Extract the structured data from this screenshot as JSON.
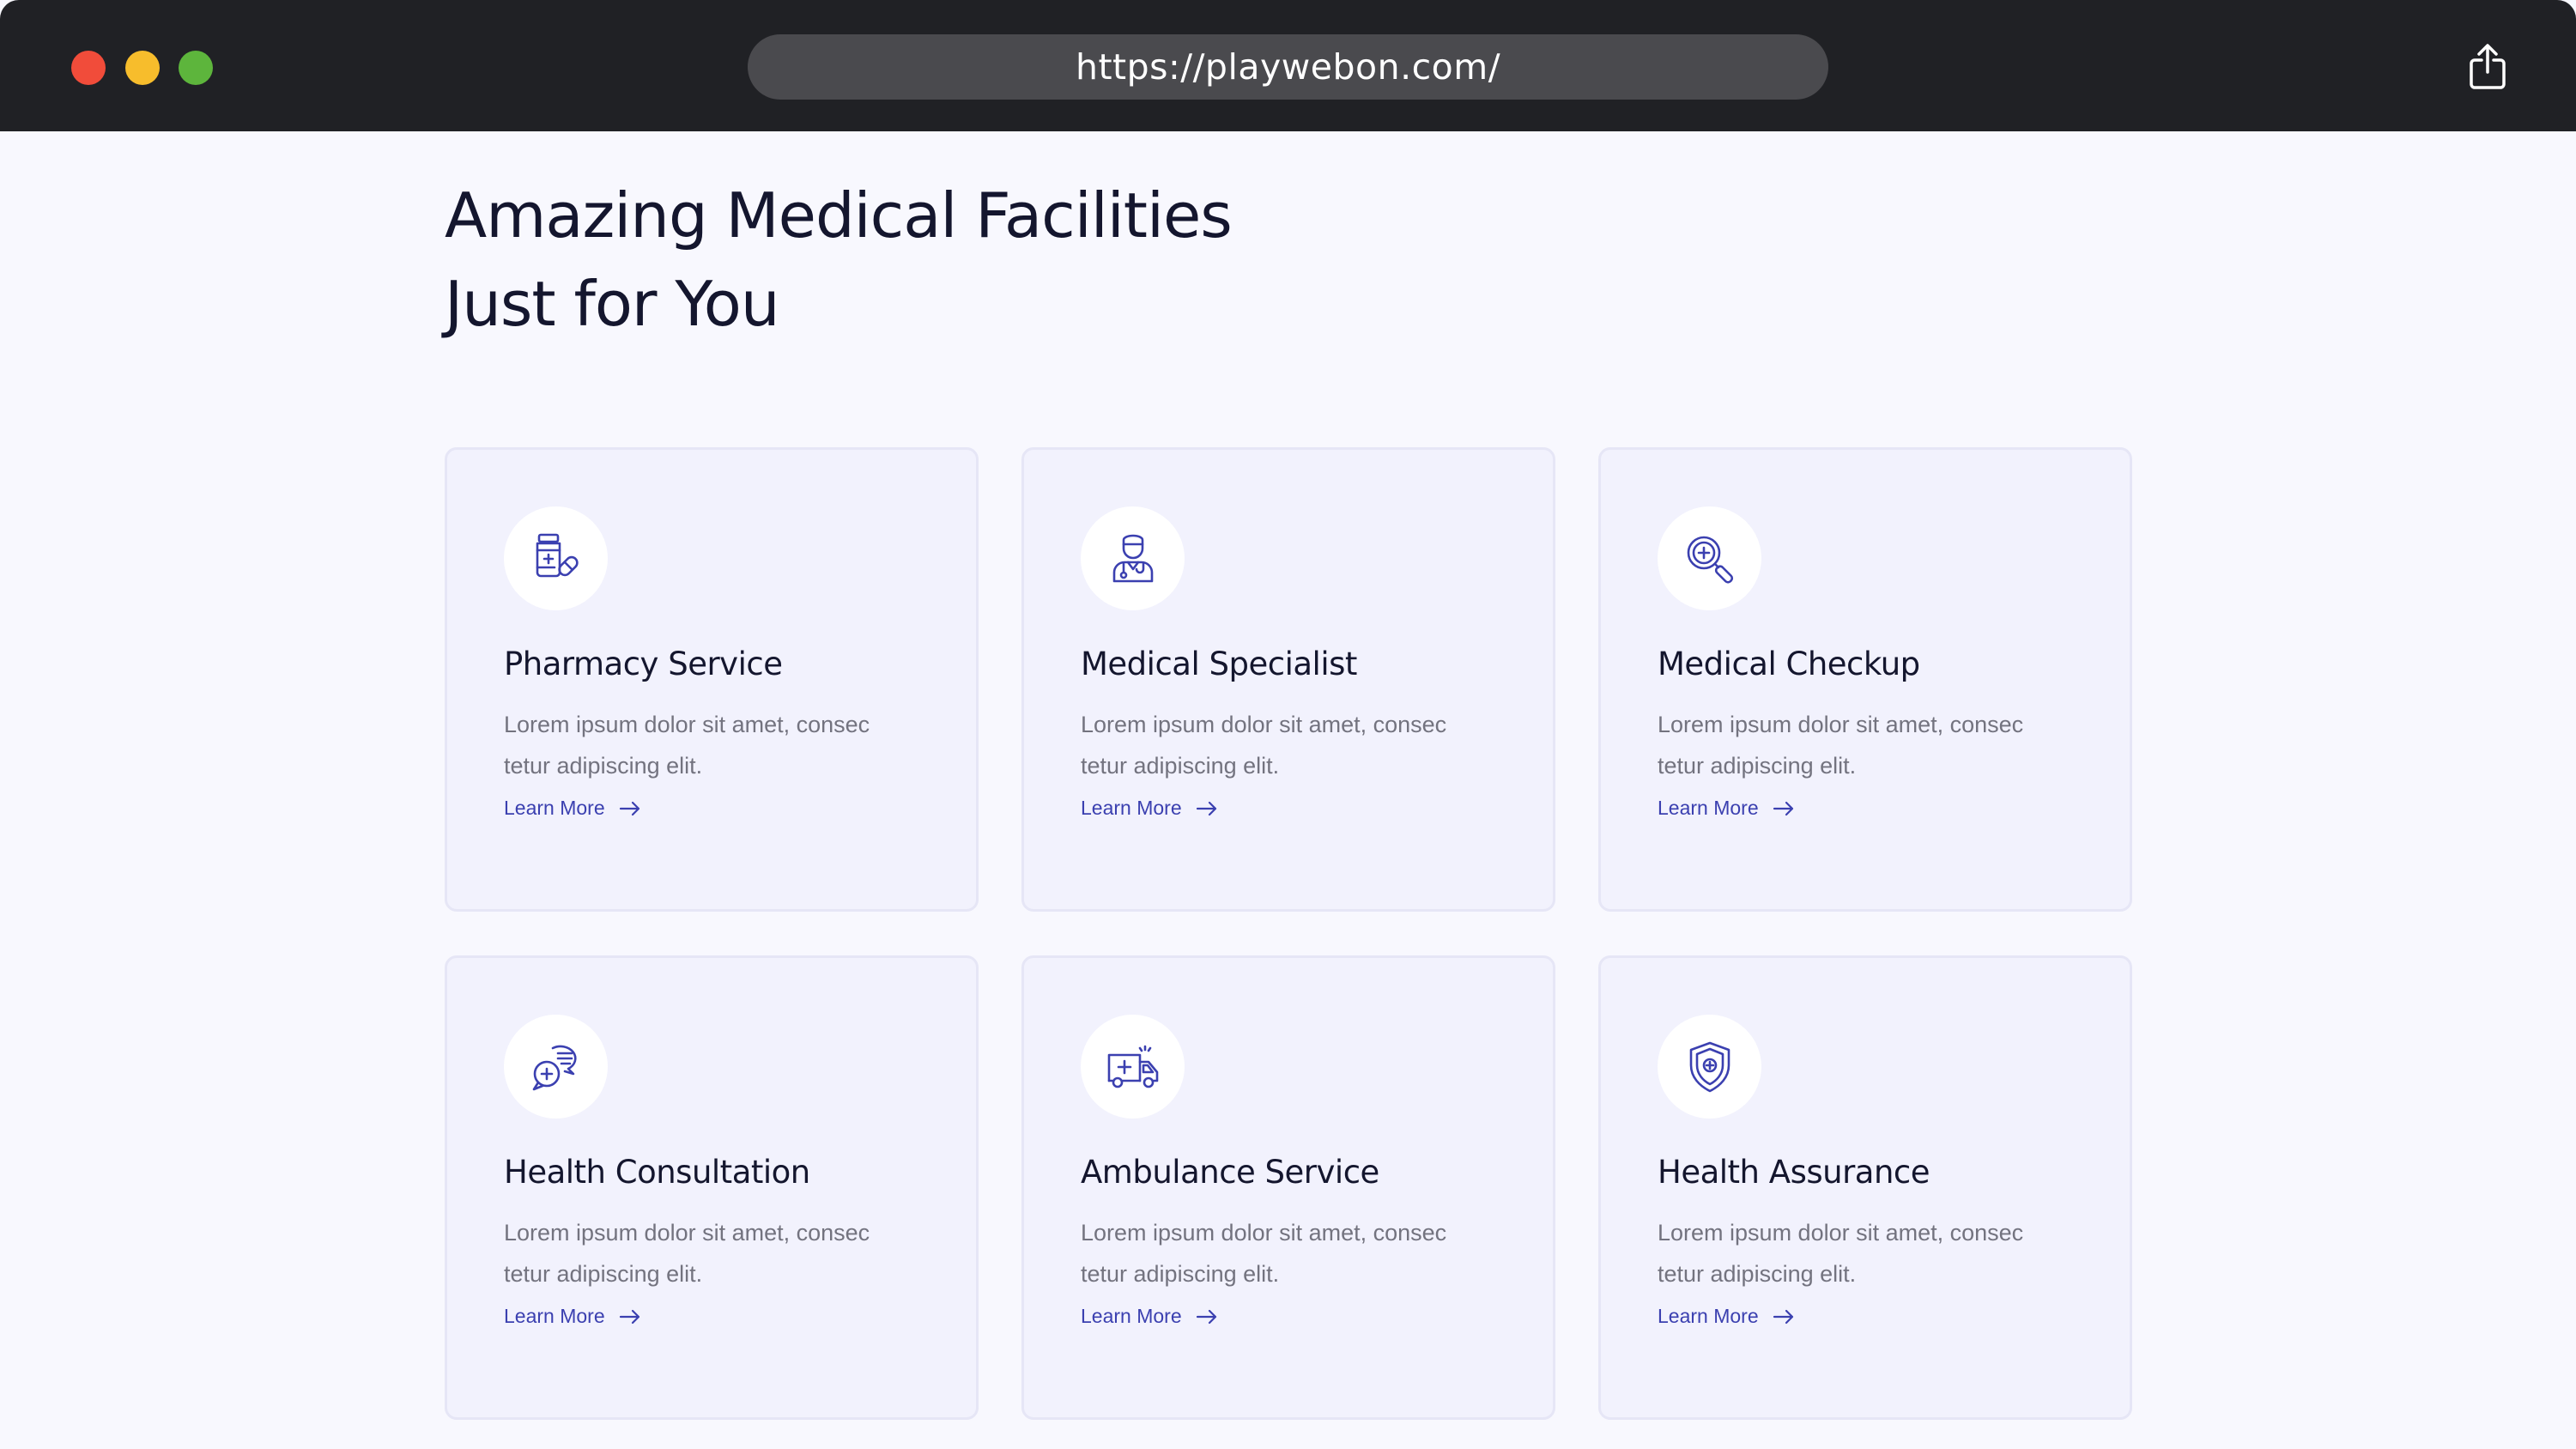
{
  "browser": {
    "url": "https://playwebon.com/",
    "traffic_lights": {
      "close": "#f14c3a",
      "minimize": "#f7bd2c",
      "maximize": "#5db53c"
    },
    "share_icon": "share-icon"
  },
  "section": {
    "title_line1": "Amazing Medical Facilities",
    "title_line2": "Just for You"
  },
  "colors": {
    "accent": "#3b40b0",
    "heading": "#14162e",
    "body_text": "#73737f",
    "card_bg": "#f2f2fd",
    "page_bg": "#f8f8fe"
  },
  "cards": [
    {
      "icon": "pharmacy-icon",
      "title": "Pharmacy Service",
      "desc_line1": "Lorem ipsum dolor sit amet, consec",
      "desc_line2": "tetur adipiscing elit.",
      "link": "Learn More"
    },
    {
      "icon": "doctor-icon",
      "title": "Medical Specialist",
      "desc_line1": "Lorem ipsum dolor sit amet, consec",
      "desc_line2": "tetur adipiscing elit.",
      "link": "Learn More"
    },
    {
      "icon": "magnifier-plus-icon",
      "title": "Medical Checkup",
      "desc_line1": "Lorem ipsum dolor sit amet, consec",
      "desc_line2": "tetur adipiscing elit.",
      "link": "Learn More"
    },
    {
      "icon": "chat-bubbles-icon",
      "title": "Health Consultation",
      "desc_line1": "Lorem ipsum dolor sit amet, consec",
      "desc_line2": "tetur adipiscing elit.",
      "link": "Learn More"
    },
    {
      "icon": "ambulance-icon",
      "title": "Ambulance Service",
      "desc_line1": "Lorem ipsum dolor sit amet, consec",
      "desc_line2": "tetur adipiscing elit.",
      "link": "Learn More"
    },
    {
      "icon": "shield-plus-icon",
      "title": "Health Assurance",
      "desc_line1": "Lorem ipsum dolor sit amet, consec",
      "desc_line2": "tetur adipiscing elit.",
      "link": "Learn More"
    }
  ]
}
